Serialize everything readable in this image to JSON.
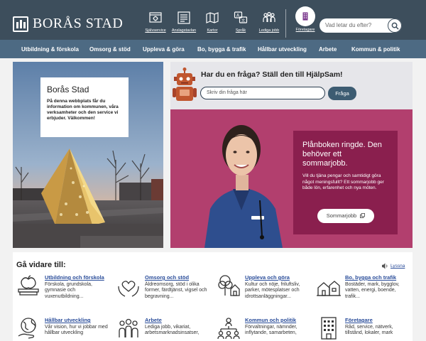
{
  "brand": {
    "name": "BORÅS STAD"
  },
  "colors": {
    "header": "#3d4e5c",
    "nav": "#4d6a83",
    "promo": "#b23f6e",
    "promo_box": "#8a1f4e",
    "link": "#2a4d9a"
  },
  "tools": [
    {
      "label": "Självservice",
      "icon": "self-service-icon"
    },
    {
      "label": "Anslagstavlan",
      "icon": "notice-board-icon"
    },
    {
      "label": "Kartor",
      "icon": "map-icon"
    },
    {
      "label": "Språk",
      "icon": "language-icon"
    },
    {
      "label": "Lediga jobb",
      "icon": "jobs-icon"
    },
    {
      "label": "Företagare",
      "icon": "building-icon"
    }
  ],
  "search": {
    "placeholder": "Vad letar du efter?"
  },
  "nav": [
    "Utbildning & förskola",
    "Omsorg & stöd",
    "Uppleva & göra",
    "Bo, bygga & trafik",
    "Hållbar utveckling",
    "Arbete",
    "Kommun & politik"
  ],
  "intro": {
    "title": "Borås Stad",
    "text": "På denna webbplats får du information om kommunen, våra verksamheter och den service vi erbjuder. Välkommen!"
  },
  "ask": {
    "title": "Har du en fråga? Ställ den till HjälpSam!",
    "placeholder": "Skriv din fråga här",
    "button": "Fråga"
  },
  "promo": {
    "heading": "Plånboken ringde. Den behöver ett sommarjobb.",
    "text": "Vill du tjäna pengar och samtidigt göra något meningsfullt? Ett sommarjobb ger både lön, erfarenhet och nya möten.",
    "button": "Sommarjobb"
  },
  "further": {
    "title": "Gå vidare till:",
    "listen": "Lyssna",
    "cards": [
      {
        "title": "Utbildning och förskola",
        "desc": "Förskola, grundskola, gymnasie och vuxenutbildning...",
        "icon": "apple-books-icon"
      },
      {
        "title": "Omsorg och stöd",
        "desc": "Äldreomsorg, stöd i olika former, färdtjänst, vigsel och begravning...",
        "icon": "heart-hands-icon"
      },
      {
        "title": "Uppleva och göra",
        "desc": "Kultur och nöje, friluftsliv, parker, mötesplatser och idrottsanläggningar...",
        "icon": "tree-house-icon"
      },
      {
        "title": "Bo, bygga och trafik",
        "desc": "Bostäder, mark, bygglov, vatten, energi, boende, trafik...",
        "icon": "houses-icon"
      },
      {
        "title": "Hållbar utveckling",
        "desc": "Vår vision, hur vi jobbar med hållbar utveckling",
        "icon": "globe-hand-icon"
      },
      {
        "title": "Arbete",
        "desc": "Lediga jobb, vikariat, arbetsmarknadsinsatser,",
        "icon": "people-icon"
      },
      {
        "title": "Kommun och politik",
        "desc": "Förvaltningar, nämnder, inflytande, samarbeten,",
        "icon": "organization-icon"
      },
      {
        "title": "Företagare",
        "desc": "Råd, service, nätverk, tillstånd, lokaler, mark",
        "icon": "office-building-icon"
      }
    ]
  }
}
